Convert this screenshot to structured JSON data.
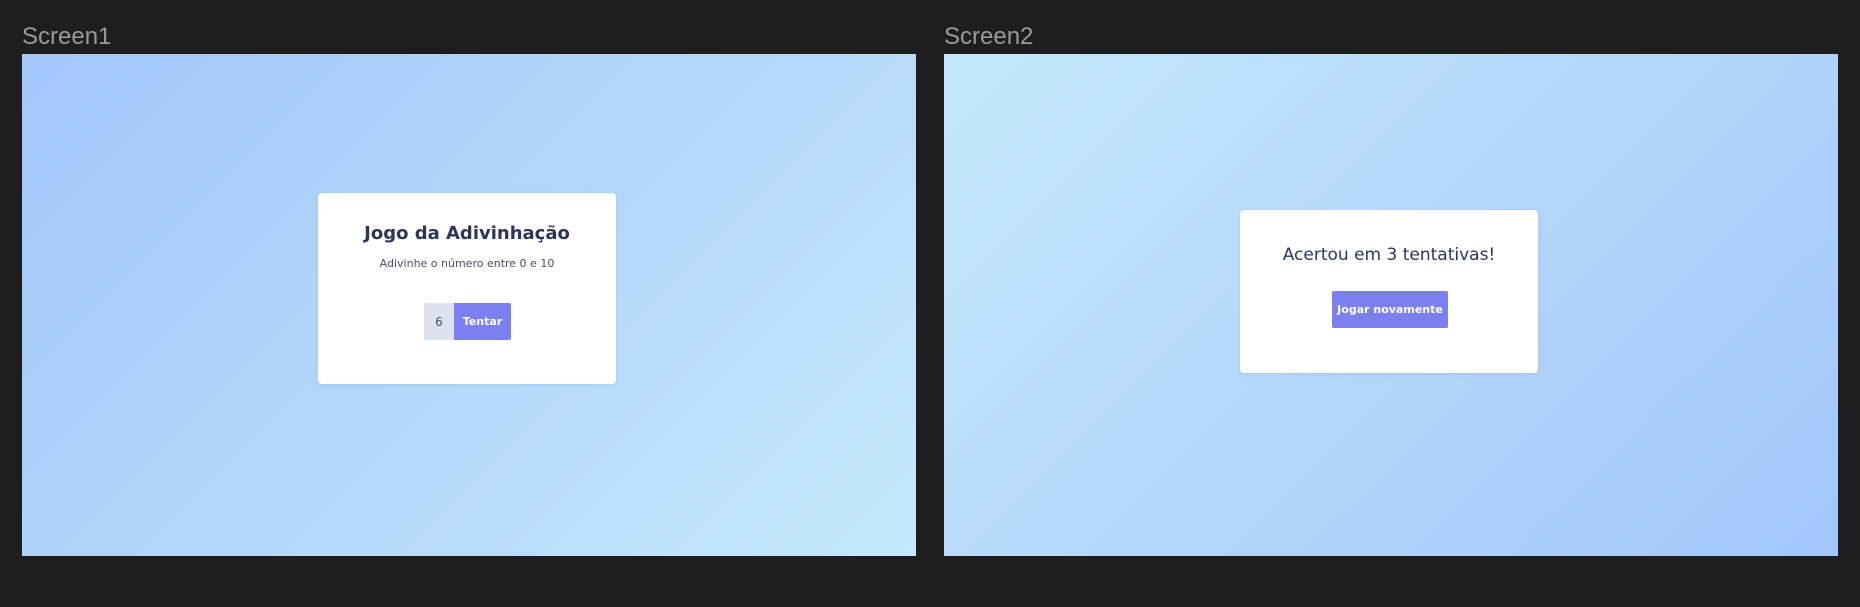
{
  "screens": [
    {
      "label": "Screen1",
      "card": {
        "title": "Jogo da Adivinhação",
        "subtitle": "Adivinhe o número entre 0 e 10",
        "guess_value": "6",
        "try_label": "Tentar"
      }
    },
    {
      "label": "Screen2",
      "card": {
        "result_text": "Acertou em 3 tentativas!",
        "play_again_label": "Jogar novamente"
      }
    }
  ],
  "colors": {
    "canvas_bg": "#1e1e1e",
    "gradient_light": "#c3e9fb",
    "gradient_dark": "#a3c6fb",
    "card_bg": "#ffffff",
    "title_text": "#2f3459",
    "button_bg": "#7b7ff0",
    "input_bg": "#dde3ee"
  }
}
